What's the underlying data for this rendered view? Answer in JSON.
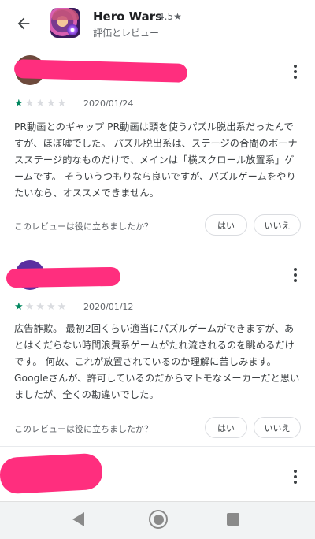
{
  "header": {
    "back_icon": "arrow-left-icon",
    "app_name": "Hero Wars",
    "rating": "4.5★",
    "subtitle": "評価とレビュー"
  },
  "colors": {
    "star_filled": "#01875f",
    "star_empty": "#dadce0",
    "redaction": "#ff2e7e",
    "text_secondary": "#5f6368"
  },
  "reviews": [
    {
      "stars": 1,
      "date": "2020/01/24",
      "text": "PR動画とのギャップ PR動画は頭を使うパズル脱出系だったんですが、ほぼ嘘でした。 パズル脱出系は、ステージの合間のボーナスステージ的なものだけで、メインは「横スクロール放置系」ゲームです。 そういうつもりなら良いですが、パズルゲームをやりたいなら、オススメできません。",
      "helpful_question": "このレビューは役に立ちましたか？",
      "yes_label": "はい",
      "no_label": "いいえ"
    },
    {
      "stars": 1,
      "date": "2020/01/12",
      "text": "広告詐欺。 最初2回くらい適当にパズルゲームができますが、あとはくだらない時間浪費系ゲームがたれ流されるのを眺めるだけです。 何故、これが放置されているのか理解に苦しみます。 Googleさんが、許可しているのだからマトモなメーカーだと思いましたが、全くの勘違いでした。",
      "helpful_question": "このレビューは役に立ちましたか？",
      "yes_label": "はい",
      "no_label": "いいえ"
    }
  ],
  "nav": {
    "back_icon": "nav-back-triangle-icon",
    "home_icon": "nav-home-circle-icon",
    "recents_icon": "nav-recents-square-icon"
  }
}
